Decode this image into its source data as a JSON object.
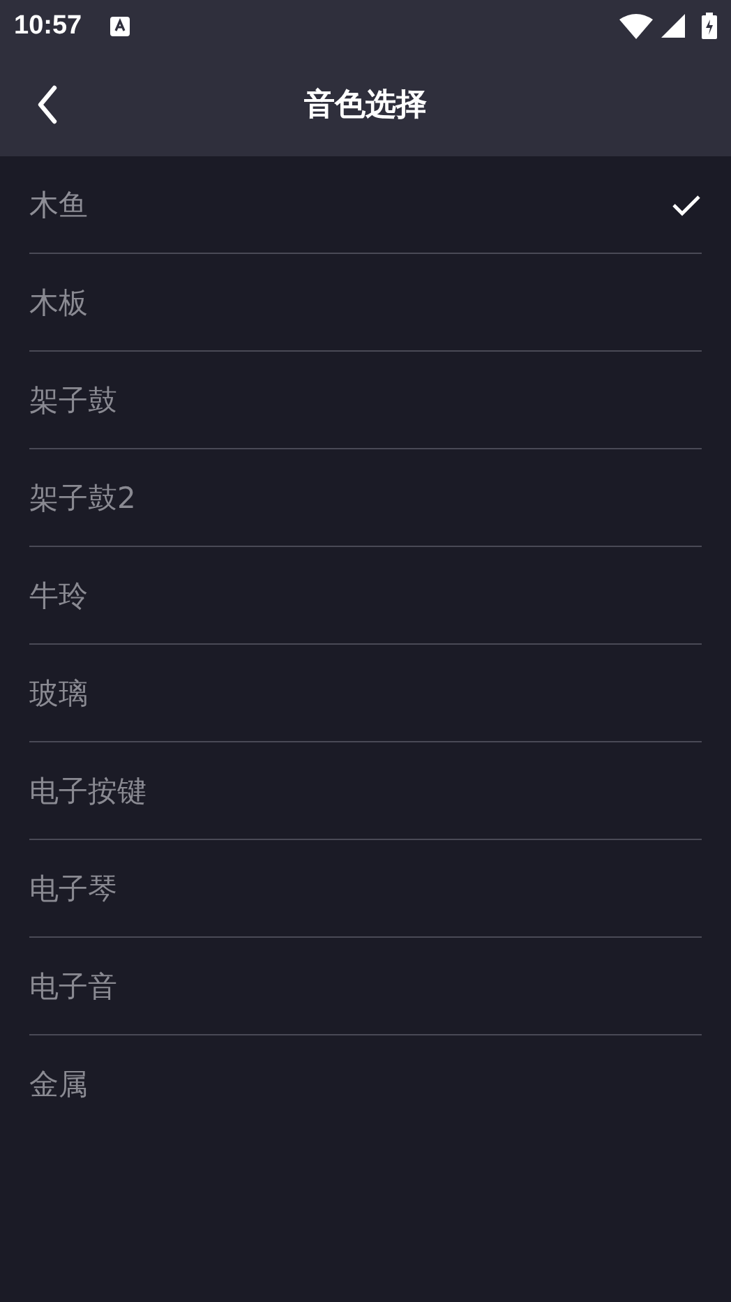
{
  "status_bar": {
    "time": "10:57"
  },
  "header": {
    "title": "音色选择"
  },
  "sounds": [
    {
      "label": "木鱼",
      "selected": true
    },
    {
      "label": "木板",
      "selected": false
    },
    {
      "label": "架子鼓",
      "selected": false
    },
    {
      "label": "架子鼓2",
      "selected": false
    },
    {
      "label": "牛玲",
      "selected": false
    },
    {
      "label": "玻璃",
      "selected": false
    },
    {
      "label": "电子按键",
      "selected": false
    },
    {
      "label": "电子琴",
      "selected": false
    },
    {
      "label": "电子音",
      "selected": false
    },
    {
      "label": "金属",
      "selected": false
    }
  ]
}
